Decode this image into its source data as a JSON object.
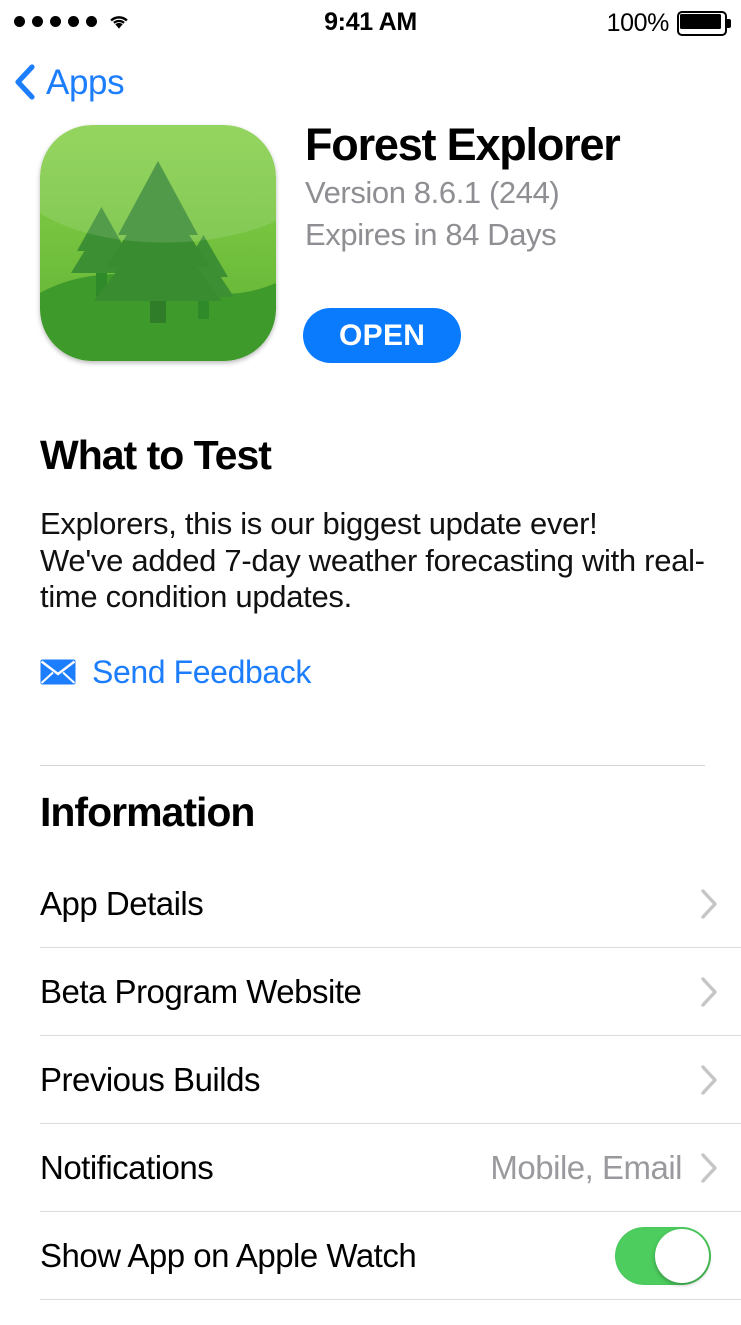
{
  "status_bar": {
    "signal_dots": 5,
    "wifi_icon": "wifi-icon",
    "time": "9:41 AM",
    "battery_percent": "100%",
    "battery_icon": "battery-full-icon"
  },
  "nav": {
    "back_icon": "chevron-left-icon",
    "back_label": "Apps"
  },
  "app": {
    "icon_name": "forest-explorer-app-icon",
    "title": "Forest Explorer",
    "version": "Version 8.6.1 (244)",
    "expires": "Expires in 84 Days",
    "open_label": "OPEN"
  },
  "what_to_test": {
    "heading": "What to Test",
    "body": "Explorers, this is our biggest update ever!\nWe've added 7-day weather forecasting with real-time condition updates.",
    "feedback_icon": "envelope-icon",
    "feedback_label": "Send Feedback"
  },
  "information": {
    "heading": "Information",
    "rows": [
      {
        "label": "App Details",
        "value": "",
        "accessory": "chevron"
      },
      {
        "label": "Beta Program Website",
        "value": "",
        "accessory": "chevron"
      },
      {
        "label": "Previous Builds",
        "value": "",
        "accessory": "chevron"
      },
      {
        "label": "Notifications",
        "value": "Mobile, Email",
        "accessory": "chevron"
      },
      {
        "label": "Show App on Apple Watch",
        "value": "",
        "accessory": "switch",
        "switch_on": true
      }
    ]
  },
  "colors": {
    "accent_blue": "#0a7bfd",
    "link_blue": "#1d7efd",
    "toggle_green": "#4ccd5e",
    "secondary_gray": "#8e8e93",
    "value_gray": "#9a9a9e",
    "destructive_red": "#ff3b30",
    "divider": "#dcdcdd",
    "background": "#ffffff"
  }
}
